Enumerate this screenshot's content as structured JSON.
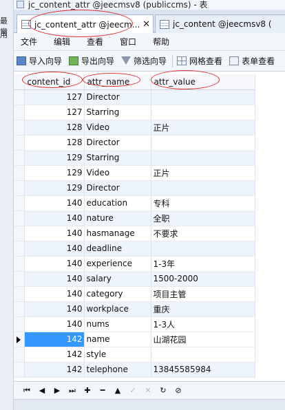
{
  "window": {
    "title": "jc_content_attr @jeecmsv8 (publiccms) - 表"
  },
  "background_window": {
    "labels": [
      "最常",
      "用"
    ]
  },
  "tabs": [
    {
      "label": "jc_content_attr @jeecm...",
      "active": true,
      "close": "✕"
    },
    {
      "label": "jc_content @jeecmsv8 (",
      "active": false
    }
  ],
  "menu": {
    "items": [
      "文件",
      "编辑",
      "查看",
      "窗口",
      "帮助"
    ]
  },
  "toolbar": {
    "import_label": "导入向导",
    "export_label": "导出向导",
    "filter_label": "筛选向导",
    "grid_label": "网格查看",
    "form_label": "表单查看"
  },
  "grid": {
    "columns": [
      "content_id",
      "attr_name",
      "attr_value"
    ],
    "rows": [
      {
        "content_id": "127",
        "attr_name": "Director",
        "attr_value": ""
      },
      {
        "content_id": "127",
        "attr_name": "Starring",
        "attr_value": ""
      },
      {
        "content_id": "128",
        "attr_name": "Video",
        "attr_value": "正片"
      },
      {
        "content_id": "128",
        "attr_name": "Director",
        "attr_value": ""
      },
      {
        "content_id": "129",
        "attr_name": "Starring",
        "attr_value": ""
      },
      {
        "content_id": "129",
        "attr_name": "Video",
        "attr_value": "正片"
      },
      {
        "content_id": "129",
        "attr_name": "Director",
        "attr_value": ""
      },
      {
        "content_id": "140",
        "attr_name": "education",
        "attr_value": "专科"
      },
      {
        "content_id": "140",
        "attr_name": "nature",
        "attr_value": "全职"
      },
      {
        "content_id": "140",
        "attr_name": "hasmanage",
        "attr_value": "不要求"
      },
      {
        "content_id": "140",
        "attr_name": "deadline",
        "attr_value": ""
      },
      {
        "content_id": "140",
        "attr_name": "experience",
        "attr_value": "1-3年"
      },
      {
        "content_id": "140",
        "attr_name": "salary",
        "attr_value": "1500-2000"
      },
      {
        "content_id": "140",
        "attr_name": "category",
        "attr_value": "项目主管"
      },
      {
        "content_id": "140",
        "attr_name": "workplace",
        "attr_value": "重庆"
      },
      {
        "content_id": "140",
        "attr_name": "nums",
        "attr_value": "1-3人"
      },
      {
        "content_id": "142",
        "attr_name": "name",
        "attr_value": "山湖花园"
      },
      {
        "content_id": "142",
        "attr_name": "style",
        "attr_value": ""
      },
      {
        "content_id": "142",
        "attr_name": "telephone",
        "attr_value": "13845585984"
      }
    ],
    "selected_row": 16
  },
  "navigator": {
    "buttons": [
      {
        "name": "first-record-button",
        "glyph": "⏮",
        "enabled": true
      },
      {
        "name": "prev-record-button",
        "glyph": "◀",
        "enabled": true
      },
      {
        "name": "next-record-button",
        "glyph": "▶",
        "enabled": true
      },
      {
        "name": "last-record-button",
        "glyph": "⏭",
        "enabled": true
      },
      {
        "name": "add-record-button",
        "glyph": "✚",
        "enabled": true
      },
      {
        "name": "delete-record-button",
        "glyph": "━",
        "enabled": true
      },
      {
        "name": "up-record-button",
        "glyph": "▲",
        "enabled": true
      },
      {
        "name": "apply-button",
        "glyph": "✓",
        "enabled": false
      },
      {
        "name": "cancel-button",
        "glyph": "✕",
        "enabled": false
      },
      {
        "name": "refresh-button",
        "glyph": "↻",
        "enabled": true
      },
      {
        "name": "stop-button",
        "glyph": "⊘",
        "enabled": true
      }
    ]
  },
  "colors": {
    "selection": "#3399ff",
    "annotation": "#e03030"
  }
}
